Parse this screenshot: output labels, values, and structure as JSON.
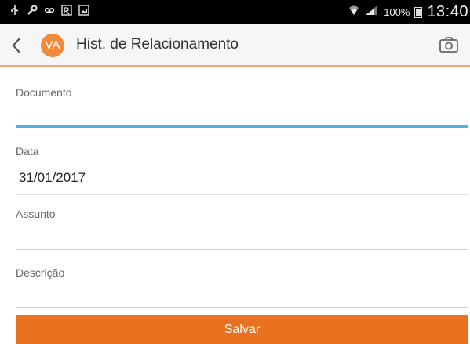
{
  "status_bar": {
    "battery_percent": "100%",
    "time": "13:40",
    "icons_left": [
      "usb-icon",
      "wrench-icon",
      "voicemail-icon",
      "prescription-icon",
      "image-icon"
    ],
    "icons_right": [
      "wifi-icon",
      "signal-icon",
      "battery-icon"
    ]
  },
  "toolbar": {
    "avatar_initials": "VA",
    "title": "Hist. de Relacionamento"
  },
  "form": {
    "documento": {
      "label": "Documento",
      "value": ""
    },
    "data": {
      "label": "Data",
      "value": "31/01/2017"
    },
    "assunto": {
      "label": "Assunto",
      "value": ""
    },
    "descricao": {
      "label": "Descrição",
      "value": ""
    }
  },
  "actions": {
    "save_label": "Salvar"
  },
  "colors": {
    "accent": "#e8721f",
    "avatar": "#f28a3c",
    "active_underline": "#4fb3dd",
    "toolbar_divider": "#f0a27a"
  }
}
